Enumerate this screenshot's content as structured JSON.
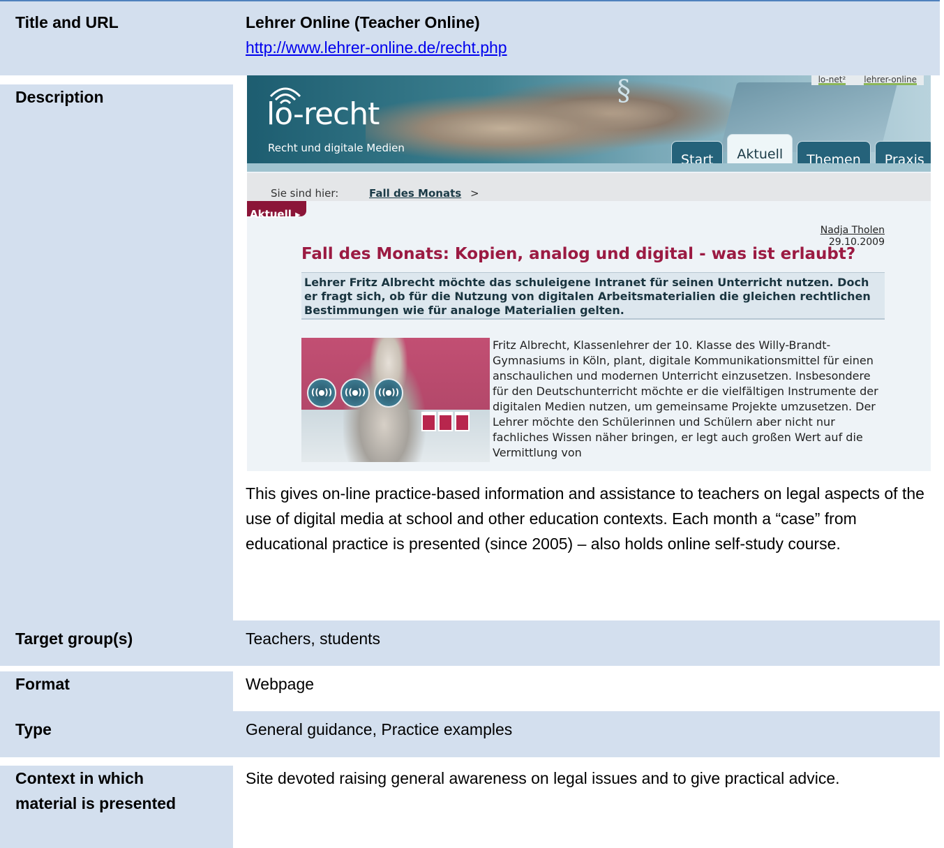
{
  "rows": {
    "title": {
      "label": "Title and URL",
      "value": "Lehrer Online (Teacher Online)",
      "url": "http://www.lehrer-online.de/recht.php"
    },
    "description": {
      "label": "Description",
      "text": "This gives on-line practice-based information and assistance to teachers on legal aspects of the use of digital media at school and other education contexts. Each month a “case” from educational practice is presented (since 2005) – also holds online self-study course."
    },
    "target": {
      "label": "Target group(s)",
      "value": "Teachers, students"
    },
    "format": {
      "label": "Format",
      "value": "Webpage"
    },
    "type": {
      "label": "Type",
      "value": "General guidance, Practice examples"
    },
    "context": {
      "label_line1": "Context in which",
      "label_line2": "material is presented",
      "value": "Site devoted raising general awareness on legal issues and to give practical advice."
    }
  },
  "screenshot": {
    "logo": "lo-recht",
    "logo_sub": "Recht und digitale Medien",
    "top_links": [
      "lo-net²",
      "lehrer-online"
    ],
    "tabs": [
      "Start",
      "Aktuell",
      "Themen",
      "Praxis"
    ],
    "breadcrumb_label": "Sie sind hier:",
    "breadcrumb_link": "Fall des Monats",
    "breadcrumb_arrow": ">",
    "section_tag": "Aktuell ▸",
    "author": "Nadja Tholen",
    "date": "29.10.2009",
    "article_title": "Fall des Monats: Kopien, analog und digital - was ist erlaubt?",
    "lead": "Lehrer Fritz Albrecht möchte das schuleigene Intranet für seinen Unterricht nutzen. Doch er fragt sich, ob für die Nutzung von digitalen Arbeitsmaterialien die gleichen rechtlichen Bestimmungen wie für analoge Materialien gelten.",
    "body": "Fritz Albrecht, Klassenlehrer der 10. Klasse des Willy-Brandt-Gymnasiums in Köln, plant, digitale Kommunikationsmittel für einen anschaulichen und modernen Unterricht einzusetzen. Insbesondere für den Deutschunterricht möchte er die vielfältigen Instrumente der digitalen Medien nutzen, um gemeinsame Projekte umzusetzen. Der Lehrer möchte den Schülerinnen und Schülern aber nicht nur fachliches Wissen näher bringen, er legt auch großen Wert auf die Vermittlung von",
    "disc_label": "((o))"
  }
}
